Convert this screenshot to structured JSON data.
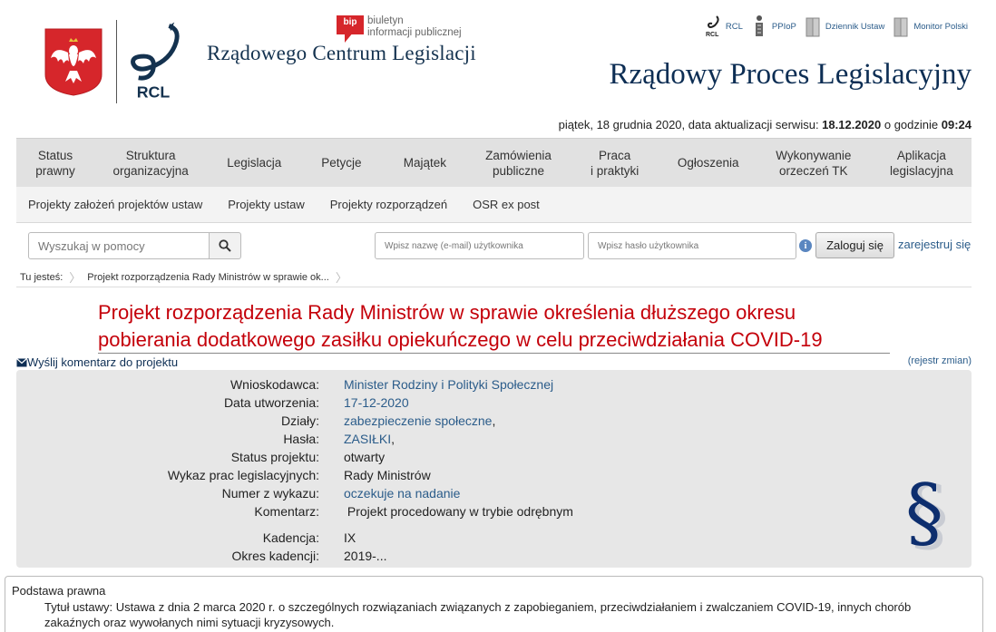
{
  "header": {
    "bip_badge": "bip",
    "bip_line1": "biuletyn",
    "bip_line2": "informacji publicznej",
    "rcl_name": "Rządowego Centrum Legislacji",
    "rcl_logo_text": "RCL",
    "site_title": "Rządowy Proces Legislacyjny",
    "top_links": [
      {
        "label": "RCL"
      },
      {
        "label": "PPIoP"
      },
      {
        "label": "Dziennik Ustaw"
      },
      {
        "label": "Monitor Polski"
      }
    ],
    "date_prefix": "piątek, 18 grudnia 2020, data aktualizacji serwisu: ",
    "date_value": "18.12.2020",
    "date_mid": " o godzinie ",
    "time_value": "09:24"
  },
  "nav": {
    "items": [
      {
        "label": "Status\nprawny"
      },
      {
        "label": "Struktura\norganizacyjna"
      },
      {
        "label": "Legislacja"
      },
      {
        "label": "Petycje"
      },
      {
        "label": "Majątek"
      },
      {
        "label": "Zamówienia\npubliczne"
      },
      {
        "label": "Praca\ni praktyki"
      },
      {
        "label": "Ogłoszenia"
      },
      {
        "label": "Wykonywanie\norzeczeń TK"
      },
      {
        "label": "Aplikacja\nlegislacyjna"
      }
    ],
    "sub_items": [
      {
        "label": "Projekty założeń projektów ustaw"
      },
      {
        "label": "Projekty ustaw"
      },
      {
        "label": "Projekty rozporządzeń"
      },
      {
        "label": "OSR ex post"
      }
    ]
  },
  "search": {
    "placeholder": "Wyszukaj w pomocy"
  },
  "login": {
    "user_placeholder": "Wpisz nazwę (e-mail) użytkownika",
    "pass_placeholder": "Wpisz hasło użytkownika",
    "info_glyph": "i",
    "login_label": "Zaloguj się",
    "register_label": "zarejestruj się"
  },
  "breadcrumb": {
    "label": "Tu jesteś:",
    "current": "Projekt rozporządzenia Rady Ministrów w sprawie ok..."
  },
  "project": {
    "title": "Projekt rozporządzenia Rady Ministrów w sprawie określenia dłuższego okresu pobierania dodatkowego zasiłku opiekuńczego w celu przeciwdziałania COVID-19",
    "comment_link": "Wyślij komentarz do projektu",
    "changes_link": "(rejestr zmian)",
    "rows": [
      {
        "label": "Wnioskodawca:",
        "value": "Minister Rodziny i Polityki Społecznej",
        "link": true
      },
      {
        "label": "Data utworzenia:",
        "value": "17-12-2020",
        "link": true
      },
      {
        "label": "Działy:",
        "value": "zabezpieczenie społeczne",
        "suffix": ",",
        "link": true
      },
      {
        "label": "Hasła:",
        "value": "ZASIŁKI",
        "suffix": ",",
        "link": true
      },
      {
        "label": "Status projektu:",
        "value": "otwarty",
        "link": false
      },
      {
        "label": "Wykaz prac legislacyjnych:",
        "value": "Rady Ministrów",
        "link": false
      },
      {
        "label": "Numer z wykazu:",
        "value": "oczekuje na nadanie",
        "link": true
      },
      {
        "label": "Komentarz:",
        "value": " Projekt procedowany w trybie odrębnym",
        "link": false
      },
      {
        "label": "Kadencja:",
        "value": "IX",
        "link": false
      },
      {
        "label": "Okres kadencji:",
        "value": "2019-...",
        "link": false
      }
    ]
  },
  "legal": {
    "title": "Podstawa prawna",
    "text": "Tytuł ustawy: Ustawa z dnia 2 marca 2020 r. o szczególnych rozwiązaniach związanych z zapobieganiem, przeciwdziałaniem i zwalczaniem COVID-19, innych chorób zakaźnych oraz wywołanych nimi sytuacji kryzysowych."
  },
  "colors": {
    "title_red": "#c4000a",
    "link_blue": "#2b5c8a",
    "navy": "#0d2e54",
    "nav_bg": "#e1e1e1",
    "details_bg": "#e7e7e7"
  }
}
